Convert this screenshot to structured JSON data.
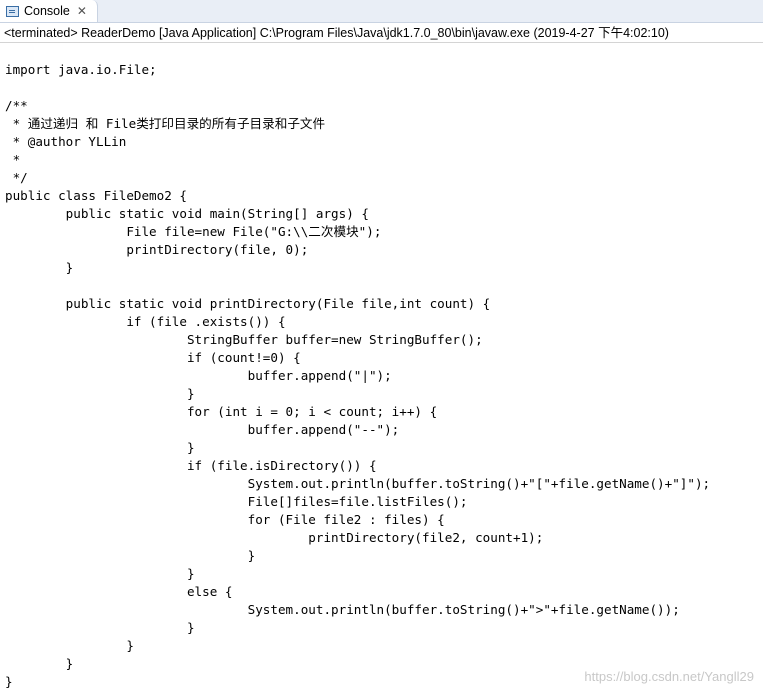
{
  "tab": {
    "label": "Console",
    "icon": "console-icon",
    "close_icon": "close-icon"
  },
  "status_line": "<terminated> ReaderDemo [Java Application] C:\\Program Files\\Java\\jdk1.7.0_80\\bin\\javaw.exe (2019-4-27 下午4:02:10)",
  "code_lines": [
    "import java.io.File;",
    "",
    "/**",
    " * 通过递归 和 File类打印目录的所有子目录和子文件",
    " * @author YLLin",
    " *",
    " */",
    "public class FileDemo2 {",
    "        public static void main(String[] args) {",
    "                File file=new File(\"G:\\\\二次模块\");",
    "                printDirectory(file, 0);",
    "        }",
    "",
    "        public static void printDirectory(File file,int count) {",
    "                if (file .exists()) {",
    "                        StringBuffer buffer=new StringBuffer();",
    "                        if (count!=0) {",
    "                                buffer.append(\"|\");",
    "                        }",
    "                        for (int i = 0; i < count; i++) {",
    "                                buffer.append(\"--\");",
    "                        }",
    "                        if (file.isDirectory()) {",
    "                                System.out.println(buffer.toString()+\"[\"+file.getName()+\"]\");",
    "                                File[]files=file.listFiles();",
    "                                for (File file2 : files) {",
    "                                        printDirectory(file2, count+1);",
    "                                }",
    "                        }",
    "                        else {",
    "                                System.out.println(buffer.toString()+\">\"+file.getName());",
    "                        }",
    "                }",
    "        }",
    "}"
  ],
  "watermark": "https://blog.csdn.net/Yangll29"
}
